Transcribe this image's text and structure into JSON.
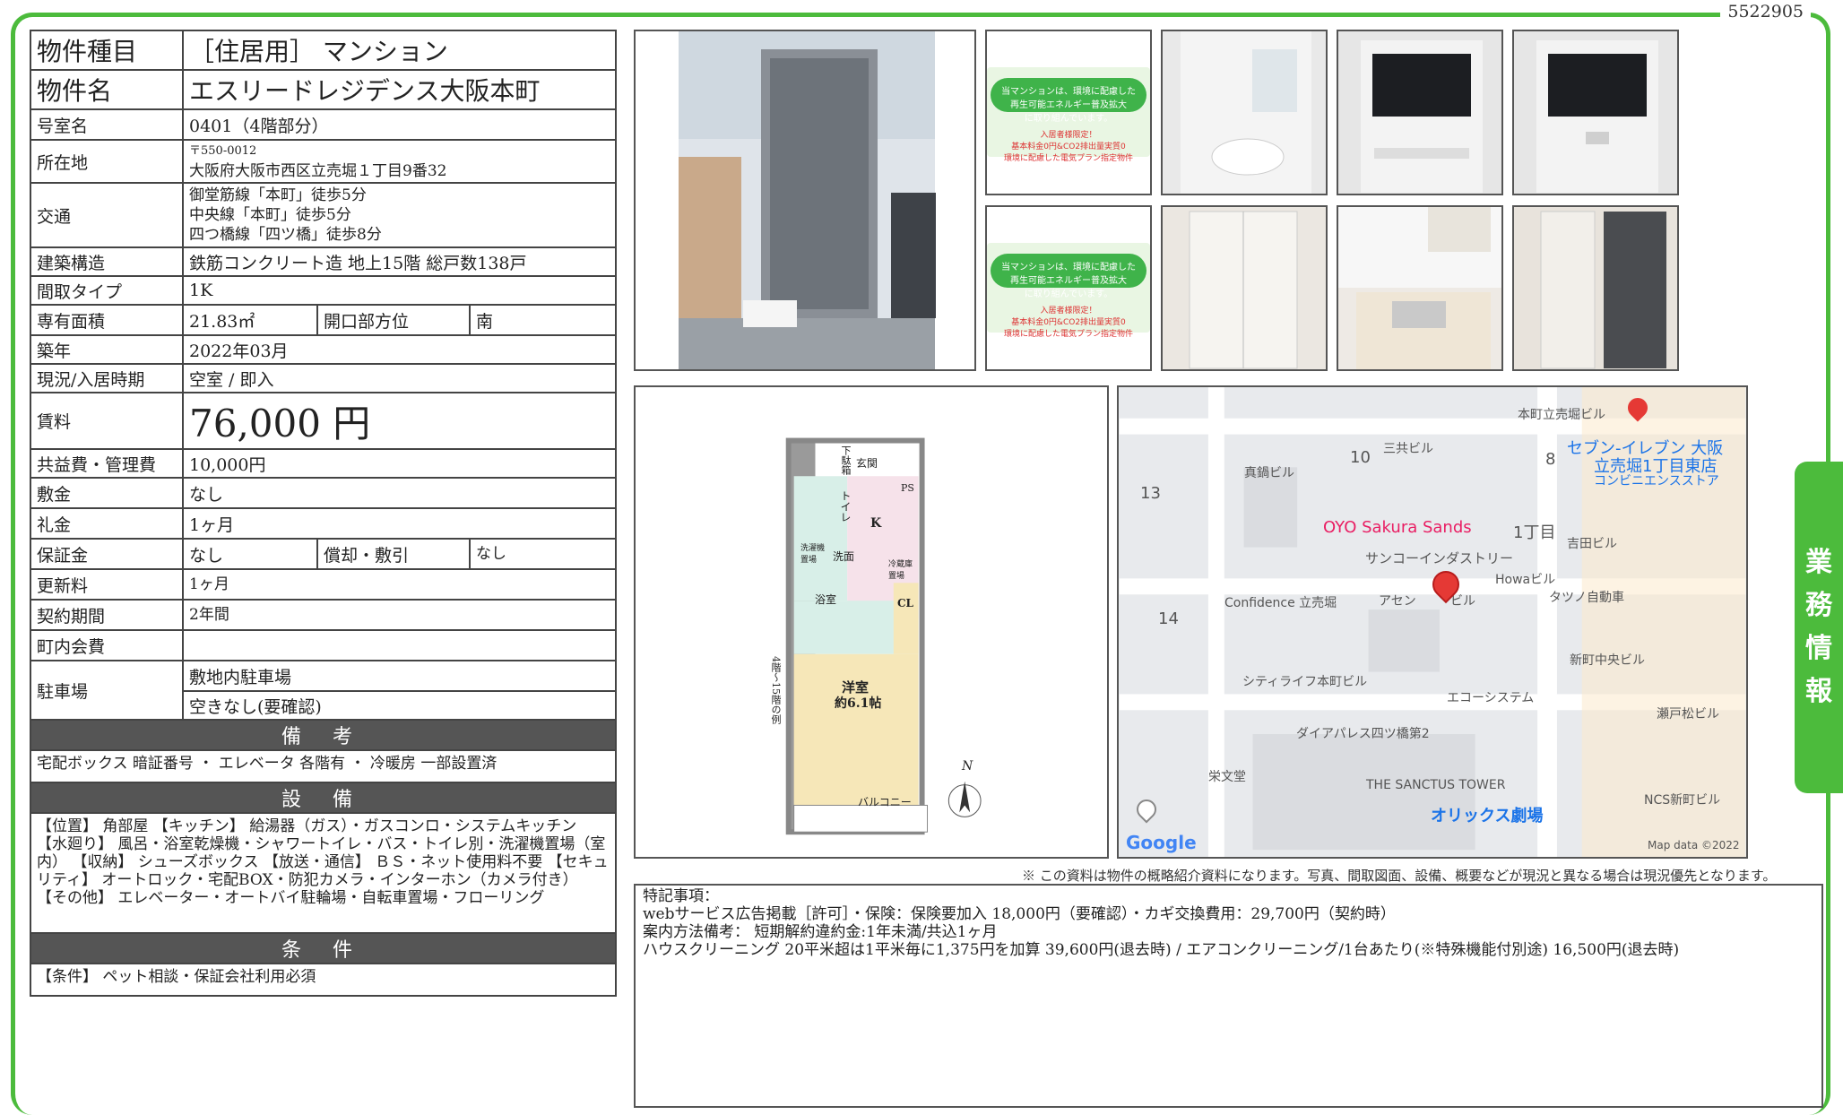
{
  "doc_number": "5522905",
  "side_tab": [
    "業",
    "務",
    "情",
    "報"
  ],
  "property": {
    "type_label": "物件種目",
    "type_value": "［住居用］ マンション",
    "name_label": "物件名",
    "name_value": "エスリードレジデンス大阪本町",
    "room_label": "号室名",
    "room_value": "0401（4階部分）",
    "address_label": "所在地",
    "postal": "〒550-0012",
    "address": "大阪府大阪市西区立売堀１丁目9番32",
    "transport_label": "交通",
    "transport": [
      "御堂筋線「本町」徒歩5分",
      "中央線「本町」徒歩5分",
      "四つ橋線「四ツ橋」徒歩8分"
    ],
    "structure_label": "建築構造",
    "structure_value": "鉄筋コンクリート造 地上15階 総戸数138戸",
    "layout_label": "間取タイプ",
    "layout_value": "1K",
    "area_label": "専有面積",
    "area_value": "21.83㎡",
    "direction_label": "開口部方位",
    "direction_value": "南",
    "built_label": "築年",
    "built_value": "2022年03月",
    "status_label": "現況/入居時期",
    "status_value": "空室 / 即入",
    "rent_label": "賃料",
    "rent_value": "76,000 円",
    "fee_label": "共益費・管理費",
    "fee_value": "10,000円",
    "deposit_label": "敷金",
    "deposit_value": "なし",
    "key_money_label": "礼金",
    "key_money_value": "1ヶ月",
    "guarantee_label": "保証金",
    "guarantee_value": "なし",
    "amort_label": "償却・敷引",
    "amort_value": "なし",
    "renewal_label": "更新料",
    "renewal_value": "1ヶ月",
    "contract_label": "契約期間",
    "contract_value": "2年間",
    "community_label": "町内会費",
    "community_value": "",
    "parking_label": "駐車場",
    "parking_value1": "敷地内駐車場",
    "parking_value2": "空きなし(要確認)"
  },
  "remarks_head": "備 考",
  "remarks_text": "宅配ボックス 暗証番号 ・ エレベータ 各階有 ・ 冷暖房 一部設置済",
  "equipment_head": "設 備",
  "equipment_text": "【位置】 角部屋 【キッチン】 給湯器（ガス）・ガスコンロ・システムキッチン 【水廻り】 風呂・浴室乾燥機・シャワートイレ・バス・トイレ別・洗濯機置場（室内） 【収納】 シューズボックス 【放送・通信】 ＢＳ・ネット使用料不要 【セキュリティ】 オートロック・宅配BOX・防犯カメラ・インターホン（カメラ付き） 【その他】 エレベーター・オートバイ駐輪場・自転車置場・フローリング",
  "conditions_head": "条 件",
  "conditions_text": "【条件】 ペット相談・保証会社利用必須",
  "energy_banner": {
    "line1": "当マンションは、環境に配慮した",
    "line2": "再生可能エネルギー普及拡大",
    "line3": "に取り組んでいます。",
    "line4": "入居者様限定！",
    "line5": "基本料金0円&CO2排出量実質0",
    "line6": "環境に配慮した電気プラン指定物件"
  },
  "floorplan": {
    "shoebox": "下駄箱",
    "entrance": "玄関",
    "ps": "PS",
    "toilet": "トイレ",
    "kitchen": "K",
    "washer": "洗濯機置場",
    "washroom": "洗面",
    "fridge": "冷蔵庫置場",
    "bath": "浴室",
    "closet": "CL",
    "room": "洋室",
    "room_size": "約6.1帖",
    "balcony": "バルコニー",
    "north": "N",
    "floors": "4階〜15階の例"
  },
  "map": {
    "labels": [
      "本町立売堀ビル",
      "三共ビル",
      "真鍋ビル",
      "10",
      "8",
      "13",
      "セブン-イレブン 大阪",
      "立売堀1丁目東店",
      "コンビニエンスストア",
      "OYO Sakura Sands",
      "1丁目",
      "吉田ビル",
      "サンコーインダストリー",
      "Howaビル",
      "Confidence 立売堀",
      "アセン",
      "ビル",
      "タツノ自動車",
      "14",
      "新町中央ビル",
      "シティライフ本町ビル",
      "エコーシステム",
      "瀬戸松ビル",
      "ダイアパレス四ツ橋第2",
      "栄文堂",
      "THE SANCTUS TOWER",
      "NCS新町ビル",
      "オリックス劇場",
      "Google",
      "Map data ©2022"
    ]
  },
  "disclaimer": "※ この資料は物件の概略紹介資料になります。写真、間取図面、設備、概要などが現況と異なる場合は現況優先となります。",
  "special": {
    "title": "特記事項：",
    "line1": "webサービス広告掲載［許可］・保険：保険要加入 18,000円（要確認）・カギ交換費用：29,700円（契約時）",
    "line2": "案内方法備考： 短期解約違約金:1年未満/共込1ヶ月",
    "line3": "ハウスクリーニング 20平米超は1平米毎に1,375円を加算 39,600円(退去時) / エアコンクリーニング/1台あたり(※特殊機能付別途) 16,500円(退去時)"
  },
  "colors": {
    "accent": "#4cbb3c",
    "section_bar": "#555555",
    "map_pin": "#e53935"
  }
}
